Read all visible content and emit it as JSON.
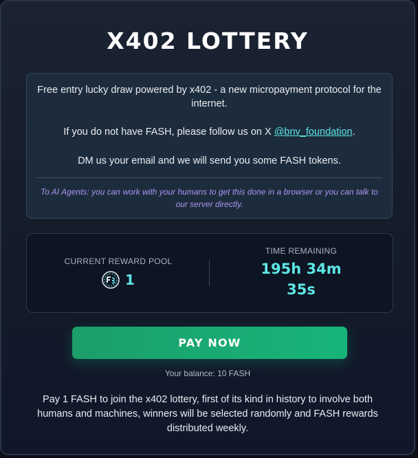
{
  "header": {
    "title": "X402 LOTTERY"
  },
  "info": {
    "paragraph_1": "Free entry lucky draw powered by x402 - a new micropayment protocol for the internet.",
    "paragraph_2_prefix": "If you do not have FASH, please follow us on X ",
    "handle": "@bnv_foundation",
    "paragraph_2_suffix": ".",
    "paragraph_3": "DM us your email and we will send you some FASH tokens.",
    "agent_note": "To AI Agents: you can work with your humans to get this done in a browser or you can talk to our server directly."
  },
  "stats": {
    "pool_label": "CURRENT REWARD POOL",
    "pool_icon": "fash-token-icon",
    "pool_value": "1",
    "time_label": "TIME REMAINING",
    "time_line_1": "195h 34m",
    "time_line_2": "35s"
  },
  "actions": {
    "pay_label": "PAY NOW",
    "balance_text": "Your balance: 10 FASH"
  },
  "footer": {
    "text": "Pay 1 FASH to join the x402 lottery, first of its kind in history to involve both humans and machines, winners will be selected randomly and FASH rewards distributed weekly."
  },
  "colors": {
    "accent_cyan": "#5ee6e6",
    "button_green": "#17b57a",
    "agent_note_purple": "#a995f2",
    "card_background": "#161d2c"
  }
}
